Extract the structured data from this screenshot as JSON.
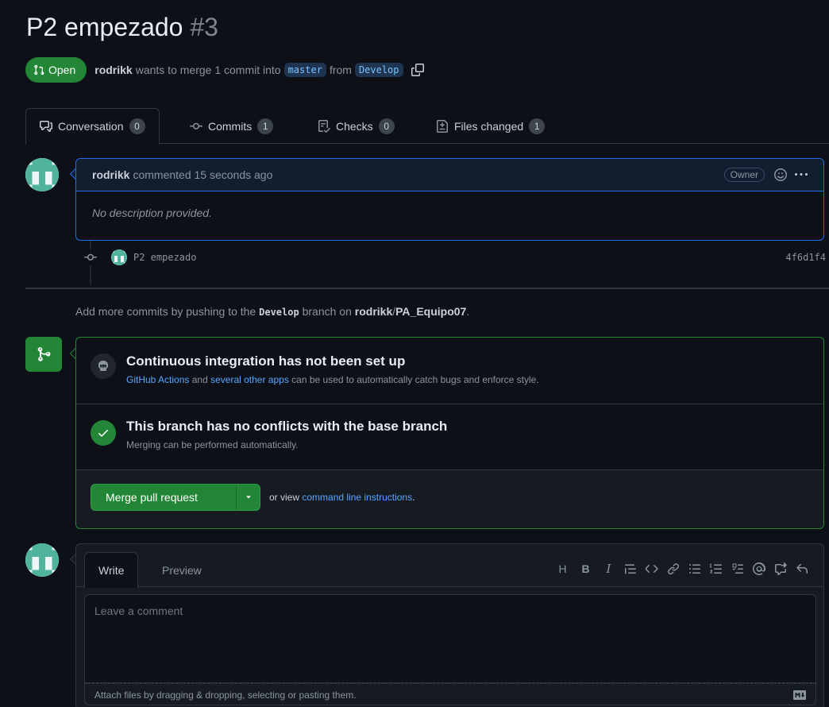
{
  "pr": {
    "title": "P2 empezado",
    "number": "#3",
    "state": "Open",
    "author": "rodrikk",
    "merge_text": "wants to merge 1 commit into",
    "base_branch": "master",
    "from_text": "from",
    "head_branch": "Develop"
  },
  "tabs": [
    {
      "label": "Conversation",
      "count": "0",
      "icon": "comment-discussion-icon"
    },
    {
      "label": "Commits",
      "count": "1",
      "icon": "git-commit-icon"
    },
    {
      "label": "Checks",
      "count": "0",
      "icon": "checklist-icon"
    },
    {
      "label": "Files changed",
      "count": "1",
      "icon": "file-diff-icon"
    }
  ],
  "comment": {
    "author": "rodrikk",
    "meta": "commented 15 seconds ago",
    "badge": "Owner",
    "body": "No description provided."
  },
  "commit": {
    "message": "P2 empezado",
    "sha": "4f6d1f4"
  },
  "push_hint": {
    "prefix": "Add more commits by pushing to the",
    "branch": "Develop",
    "middle": "branch on",
    "owner": "rodrikk",
    "repo": "PA_Equipo07",
    "suffix": "."
  },
  "merge": {
    "ci_title": "Continuous integration has not been set up",
    "ci_link1": "GitHub Actions",
    "ci_and": "and",
    "ci_link2": "several other apps",
    "ci_rest": "can be used to automatically catch bugs and enforce style.",
    "conflict_title": "This branch has no conflicts with the base branch",
    "conflict_sub": "Merging can be performed automatically.",
    "button": "Merge pull request",
    "or_view": "or view",
    "cli_link": "command line instructions",
    "cli_suffix": "."
  },
  "editor": {
    "tab_write": "Write",
    "tab_preview": "Preview",
    "placeholder": "Leave a comment",
    "attach": "Attach files by dragging & dropping, selecting or pasting them.",
    "toolbar": [
      "H",
      "B",
      "I"
    ]
  },
  "colors": {
    "open_green": "#238636",
    "accent_blue": "#1f6feb",
    "link": "#58a6ff"
  }
}
